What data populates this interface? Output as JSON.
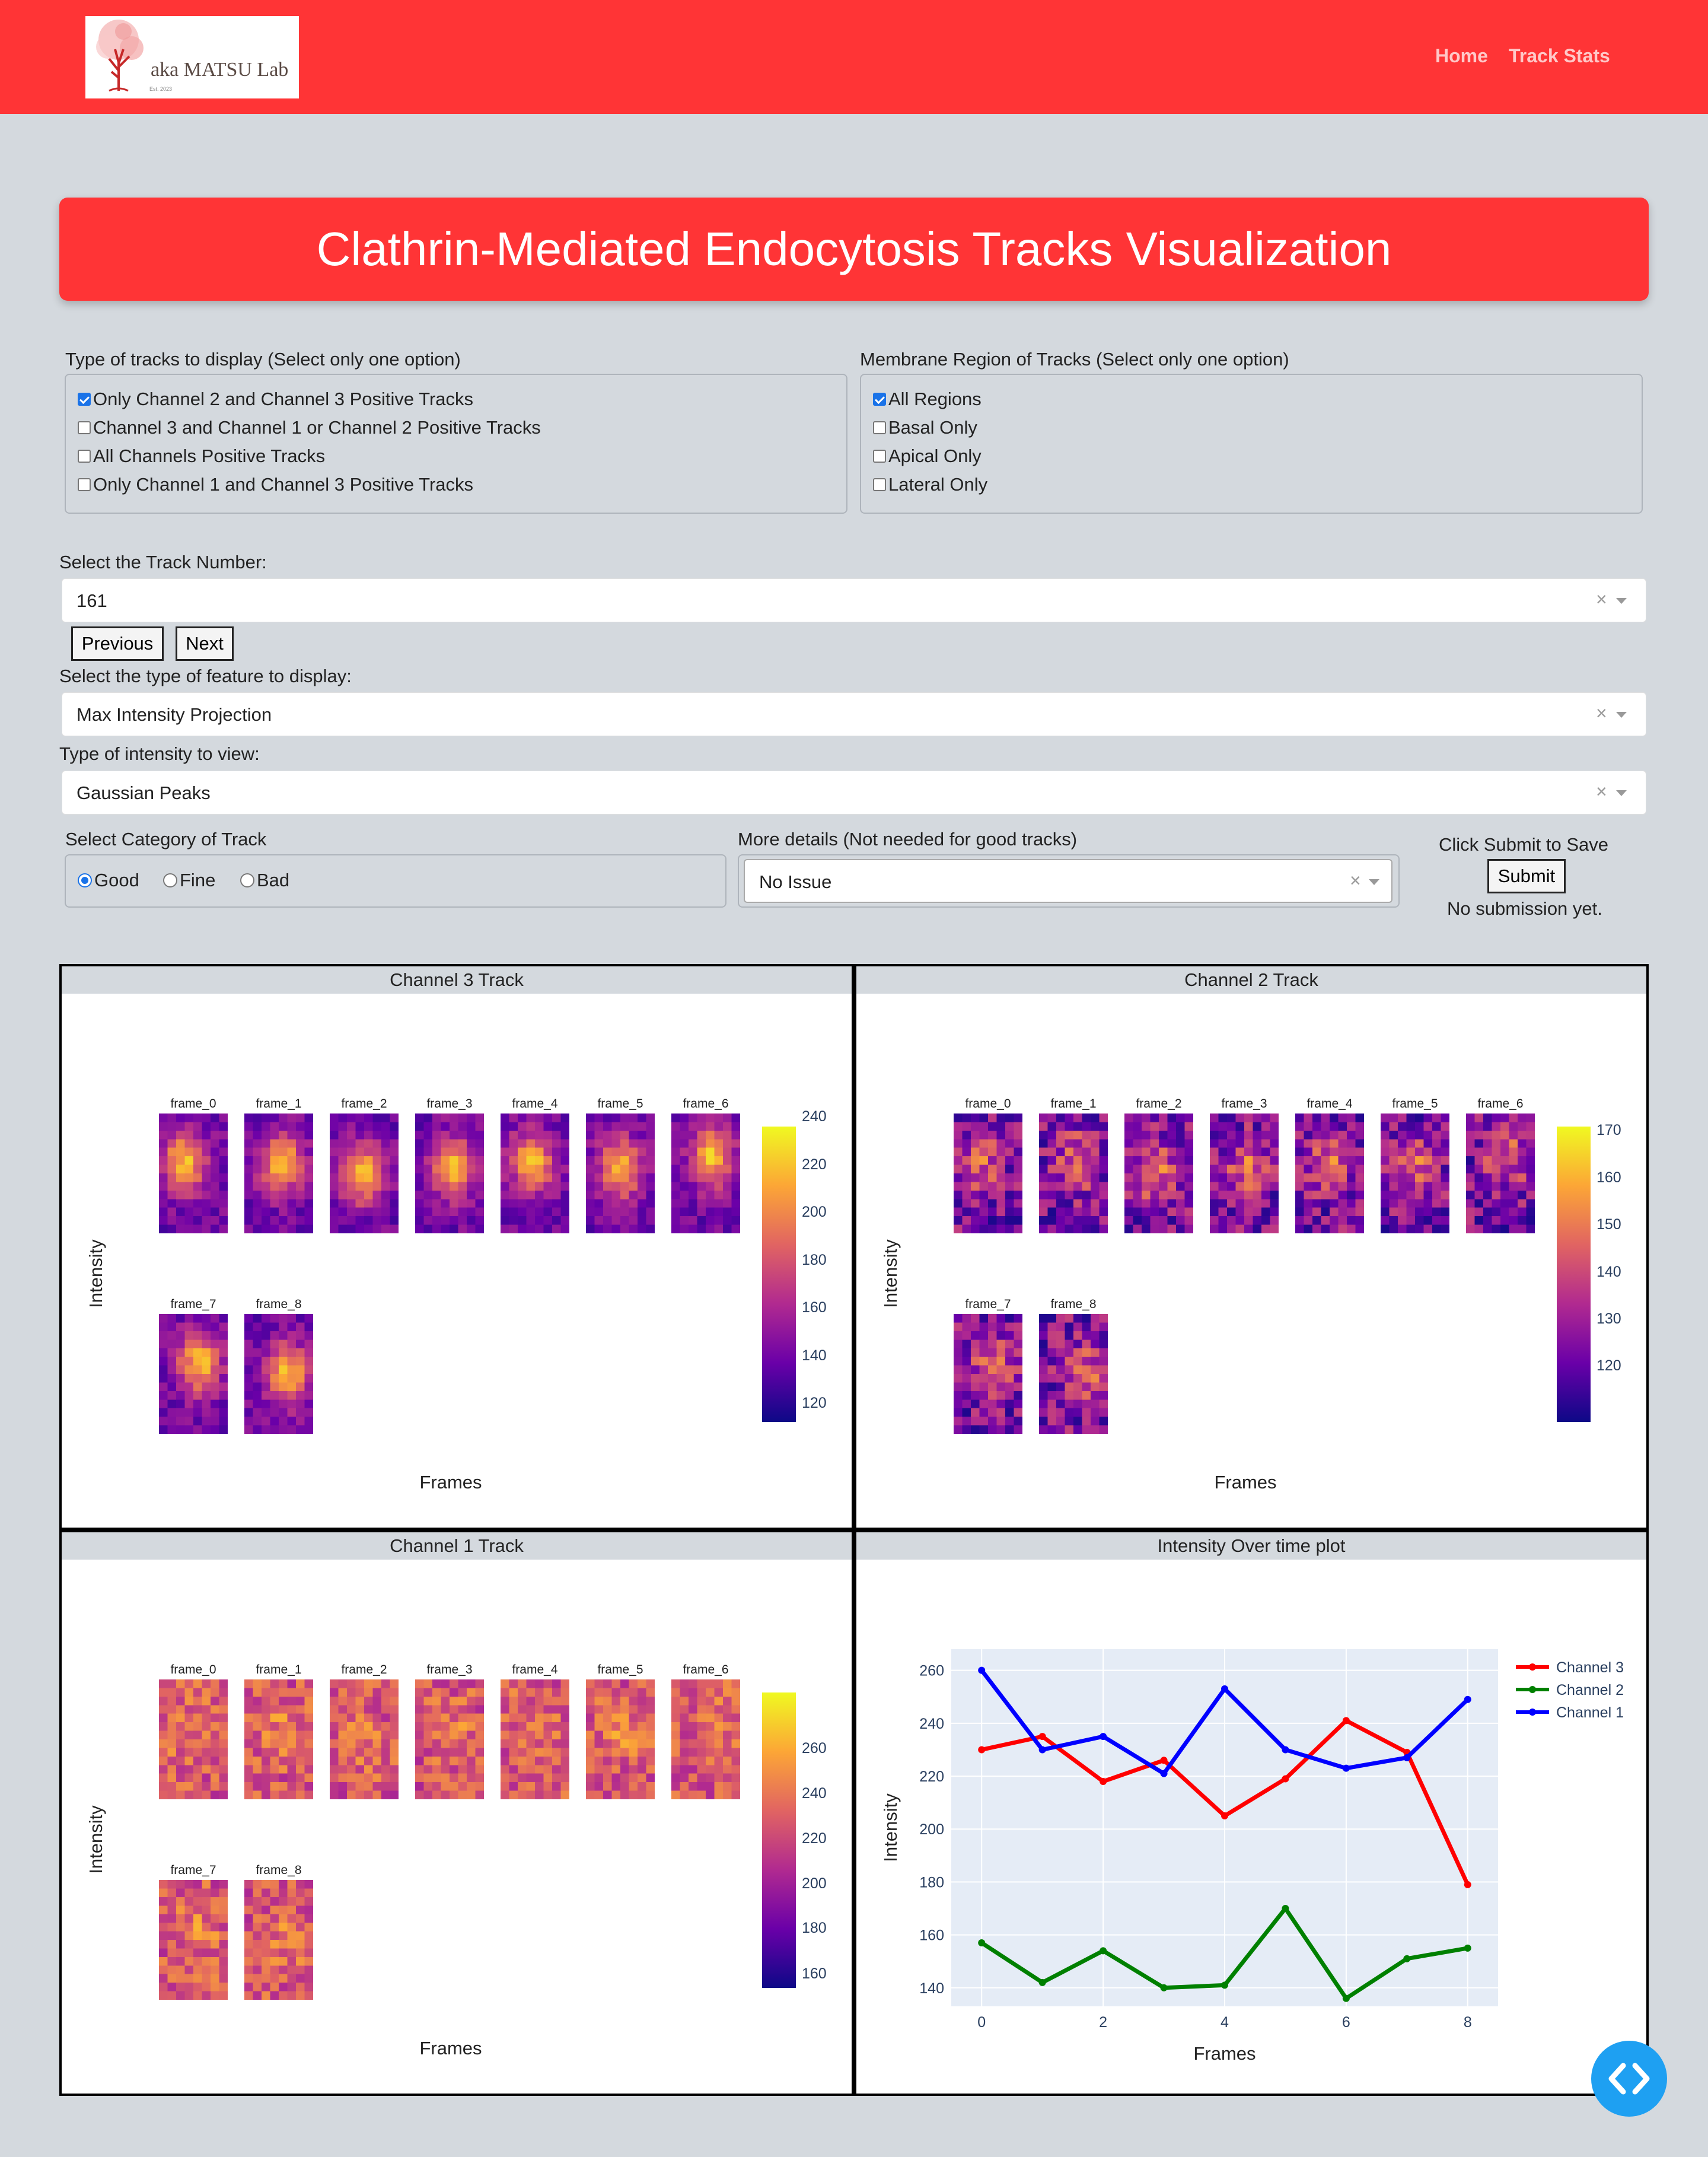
{
  "navbar": {
    "logo_text": "aka MATSU Lab",
    "logo_est": "Est. 2023",
    "links": [
      "Home",
      "Track Stats"
    ]
  },
  "title": "Clathrin-Mediated Endocytosis Tracks Visualization",
  "track_type": {
    "label": "Type of tracks to display (Select only one option)",
    "options": [
      {
        "label": "Only Channel 2 and Channel 3 Positive Tracks",
        "checked": true
      },
      {
        "label": "Channel 3 and Channel 1 or Channel 2 Positive Tracks",
        "checked": false
      },
      {
        "label": "All Channels Positive Tracks",
        "checked": false
      },
      {
        "label": "Only Channel 1 and Channel 3 Positive Tracks",
        "checked": false
      }
    ]
  },
  "membrane": {
    "label": "Membrane Region of Tracks (Select only one option)",
    "options": [
      {
        "label": "All Regions",
        "checked": true
      },
      {
        "label": "Basal Only",
        "checked": false
      },
      {
        "label": "Apical Only",
        "checked": false
      },
      {
        "label": "Lateral Only",
        "checked": false
      }
    ]
  },
  "track_number": {
    "label": "Select the Track Number:",
    "value": "161",
    "clear": "×",
    "prev": "Previous",
    "next": "Next"
  },
  "feature": {
    "label": "Select the type of feature to display:",
    "value": "Max Intensity Projection",
    "clear": "×"
  },
  "intensity": {
    "label": "Type of intensity to view:",
    "value": "Gaussian Peaks",
    "clear": "×"
  },
  "category": {
    "label": "Select Category of Track",
    "options": [
      {
        "label": "Good",
        "checked": true
      },
      {
        "label": "Fine",
        "checked": false
      },
      {
        "label": "Bad",
        "checked": false
      }
    ]
  },
  "details": {
    "label": "More details (Not needed for good tracks)",
    "value": "No Issue",
    "clear": "×"
  },
  "submit": {
    "label": "Click Submit to Save",
    "button": "Submit",
    "status": "No submission yet."
  },
  "panels": [
    {
      "title": "Channel 3 Track",
      "xlabel": "Frames",
      "ylabel": "Intensity",
      "colorbar_ticks": [
        "240",
        "220",
        "200",
        "180",
        "160",
        "140",
        "120"
      ],
      "frames": [
        "frame_0",
        "frame_1",
        "frame_2",
        "frame_3",
        "frame_4",
        "frame_5",
        "frame_6",
        "frame_7",
        "frame_8"
      ]
    },
    {
      "title": "Channel 2 Track",
      "xlabel": "Frames",
      "ylabel": "Intensity",
      "colorbar_ticks": [
        "170",
        "160",
        "150",
        "140",
        "130",
        "120"
      ],
      "frames": [
        "frame_0",
        "frame_1",
        "frame_2",
        "frame_3",
        "frame_4",
        "frame_5",
        "frame_6",
        "frame_7",
        "frame_8"
      ]
    },
    {
      "title": "Channel 1 Track",
      "xlabel": "Frames",
      "ylabel": "Intensity",
      "colorbar_ticks": [
        "260",
        "240",
        "220",
        "200",
        "180",
        "160"
      ],
      "frames": [
        "frame_0",
        "frame_1",
        "frame_2",
        "frame_3",
        "frame_4",
        "frame_5",
        "frame_6",
        "frame_7",
        "frame_8"
      ]
    }
  ],
  "line_panel_title": "Intensity Over time plot",
  "chart_data": {
    "type": "line",
    "xlabel": "Frames",
    "ylabel": "Intensity",
    "x": [
      0,
      1,
      2,
      3,
      4,
      5,
      6,
      7,
      8
    ],
    "xticks": [
      0,
      2,
      4,
      6,
      8
    ],
    "yticks": [
      140,
      160,
      180,
      200,
      220,
      240,
      260
    ],
    "ylim": [
      133,
      268
    ],
    "xlim": [
      -0.5,
      8.5
    ],
    "legend": "top-right",
    "grid": true,
    "series": [
      {
        "name": "Channel 3",
        "color": "#ff0000",
        "values": [
          230,
          235,
          218,
          226,
          205,
          219,
          241,
          229,
          179
        ]
      },
      {
        "name": "Channel 2",
        "color": "#008000",
        "values": [
          157,
          142,
          154,
          140,
          141,
          170,
          136,
          151,
          155
        ]
      },
      {
        "name": "Channel 1",
        "color": "#0000ff",
        "values": [
          260,
          230,
          235,
          221,
          253,
          230,
          223,
          227,
          249
        ]
      }
    ]
  }
}
